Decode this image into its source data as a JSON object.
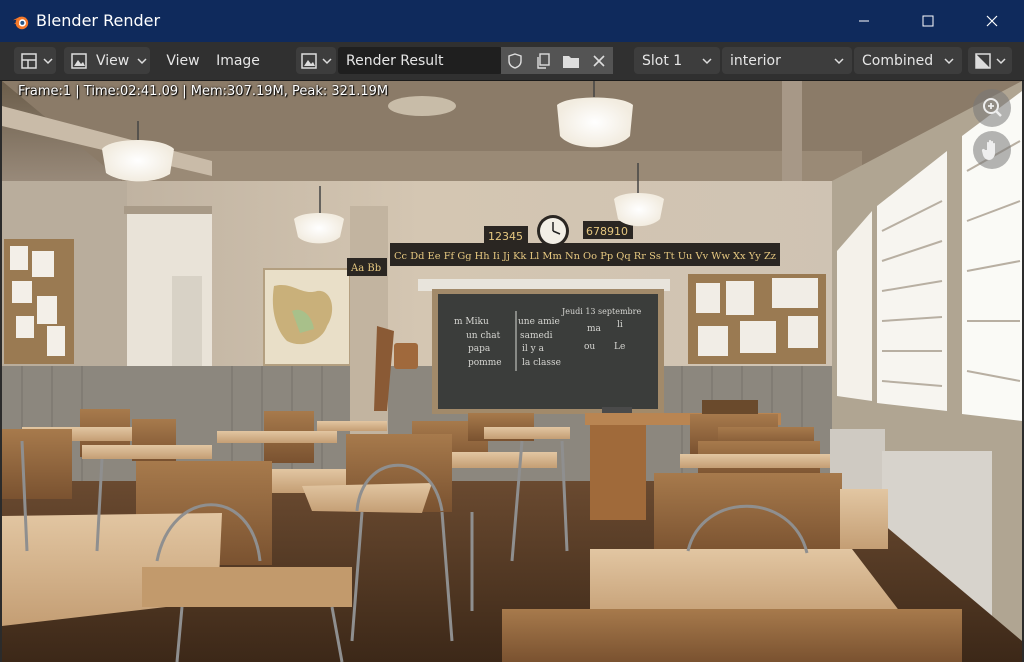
{
  "window": {
    "title": "Blender Render",
    "controls": {
      "minimize": "—",
      "maximize": "☐",
      "close": "✕"
    }
  },
  "header": {
    "editor_type_icon": "image-editor-icon",
    "view_mode_icon": "image-view-icon",
    "view_dropdown_label": "View",
    "menus": [
      "View",
      "Image"
    ],
    "image_browse_icon": "image-browse-icon",
    "image_name": "Render Result",
    "slot": "Slot 1",
    "view_layer": "interior",
    "pass": "Combined",
    "display_channels_icon": "display-channels-icon"
  },
  "viewer": {
    "stats": "Frame:1 | Time:02:41.09 | Mem:307.19M, Peak: 321.19M",
    "zoom_icon": "zoom-icon",
    "pan_icon": "hand-pan-icon"
  },
  "render": {
    "number_card_left": "12345",
    "number_card_right": "678910",
    "alphabet_left": "Aa Bb",
    "alphabet_right": "Cc Dd Ee Ff Gg Hh Ii Jj Kk Ll Mm Nn Oo Pp Qq Rr Ss Tt Uu Vv Ww Xx Yy Zz",
    "blackboard_lines_left": [
      "m Miku",
      "un chat",
      "papa",
      "pomme"
    ],
    "blackboard_lines_mid": [
      "une amie",
      "samedi",
      "il y a",
      "la classe"
    ],
    "blackboard_date": "Jeudi 13 septembre",
    "blackboard_words": [
      "ma",
      "li",
      "ou",
      "Le"
    ]
  },
  "colors": {
    "titlebar": "#0f2a5c",
    "header": "#303030",
    "field": "#1f1f1f",
    "button": "#3d3d3d"
  }
}
